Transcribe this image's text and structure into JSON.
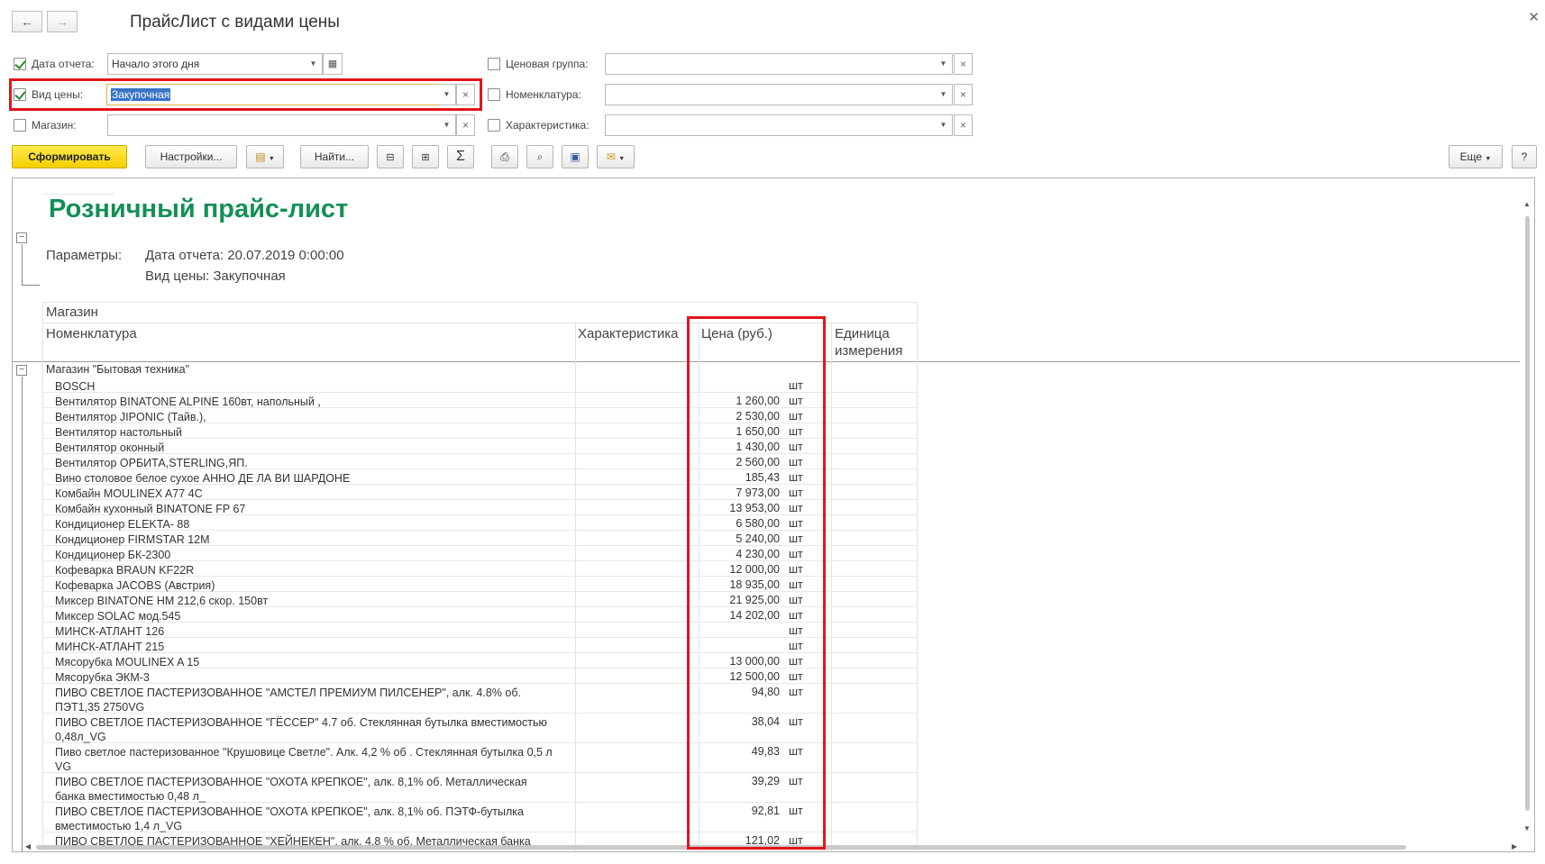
{
  "window": {
    "title": "ПрайсЛист с видами цены",
    "back_icon": "arrow-left-icon",
    "forward_icon": "arrow-right-icon",
    "close_icon": "close-icon"
  },
  "filters": {
    "report_date": {
      "label": "Дата отчета:",
      "value": "Начало этого дня",
      "checked": true
    },
    "price_type": {
      "label": "Вид цены:",
      "value": "Закупочная",
      "checked": true
    },
    "store": {
      "label": "Магазин:",
      "value": "",
      "checked": false
    },
    "price_group": {
      "label": "Ценовая группа:",
      "value": "",
      "checked": false
    },
    "nomenclature": {
      "label": "Номенклатура:",
      "value": "",
      "checked": false
    },
    "characteristic": {
      "label": "Характеристика:",
      "value": "",
      "checked": false
    }
  },
  "toolbar": {
    "generate": "Сформировать",
    "settings": "Настройки...",
    "find": "Найти...",
    "more": "Еще",
    "help": "?"
  },
  "report": {
    "title": "Розничный прайс-лист",
    "params_label": "Параметры:",
    "param_date": "Дата отчета: 20.07.2019 0:00:00",
    "param_price_type": "Вид цены: Закупочная",
    "header": {
      "store": "Магазин",
      "nomenclature": "Номенклатура",
      "characteristic": "Характеристика",
      "price": "Цена (руб.)",
      "unit_line1": "Единица",
      "unit_line2": "измерения"
    },
    "group": "Магазин \"Бытовая техника\"",
    "rows": [
      {
        "name": "BOSCH",
        "price": "",
        "unit": "шт"
      },
      {
        "name": "Вентилятор BINATONE ALPINE 160вт, напольный ,",
        "price": "1 260,00",
        "unit": "шт"
      },
      {
        "name": "Вентилятор JIPONIC (Тайв.),",
        "price": "2 530,00",
        "unit": "шт"
      },
      {
        "name": "Вентилятор настольный",
        "price": "1 650,00",
        "unit": "шт"
      },
      {
        "name": "Вентилятор оконный",
        "price": "1 430,00",
        "unit": "шт"
      },
      {
        "name": "Вентилятор ОРБИТА,STERLING,ЯП.",
        "price": "2 560,00",
        "unit": "шт"
      },
      {
        "name": "Вино столовое белое сухое АННО ДЕ ЛА ВИ ШАРДОНЕ",
        "price": "185,43",
        "unit": "шт"
      },
      {
        "name": "Комбайн MOULINEX  A77 4C",
        "price": "7 973,00",
        "unit": "шт"
      },
      {
        "name": "Комбайн кухонный BINATONE FP 67",
        "price": "13 953,00",
        "unit": "шт"
      },
      {
        "name": "Кондиционер ELEKTA- 88",
        "price": "6 580,00",
        "unit": "шт"
      },
      {
        "name": "Кондиционер FIRMSTAR 12M",
        "price": "5 240,00",
        "unit": "шт"
      },
      {
        "name": "Кондиционер БК-2300",
        "price": "4 230,00",
        "unit": "шт"
      },
      {
        "name": "Кофеварка BRAUN KF22R",
        "price": "12 000,00",
        "unit": "шт"
      },
      {
        "name": "Кофеварка JACOBS (Австрия)",
        "price": "18 935,00",
        "unit": "шт"
      },
      {
        "name": "Миксер BINATONE HM 212,6 скор. 150вт",
        "price": "21 925,00",
        "unit": "шт"
      },
      {
        "name": "Миксер SOLAC мод.545",
        "price": "14 202,00",
        "unit": "шт"
      },
      {
        "name": "МИНСК-АТЛАНТ 126",
        "price": "",
        "unit": "шт"
      },
      {
        "name": "МИНСК-АТЛАНТ 215",
        "price": "",
        "unit": "шт"
      },
      {
        "name": "Мясорубка MOULINEX  A 15",
        "price": "13 000,00",
        "unit": "шт"
      },
      {
        "name": "Мясорубка ЭКМ-3",
        "price": "12 500,00",
        "unit": "шт"
      },
      {
        "name": "ПИВО СВЕТЛОЕ ПАСТЕРИЗОВАННОЕ \"АМСТЕЛ ПРЕМИУМ ПИЛСЕНЕР\", алк. 4.8% об. ПЭТ1,35 2750VG",
        "price": "94,80",
        "unit": "шт"
      },
      {
        "name": "ПИВО СВЕТЛОЕ ПАСТЕРИЗОВАННОЕ \"ГЁССЕР\" 4.7 об. Стеклянная бутылка вместимостью 0,48л_VG",
        "price": "38,04",
        "unit": "шт"
      },
      {
        "name": "Пиво светлое пастеризованное \"Крушовице Светле\". Алк. 4,2 % об . Стеклянная бутылка 0,5 л VG",
        "price": "49,83",
        "unit": "шт"
      },
      {
        "name": "ПИВО СВЕТЛОЕ ПАСТЕРИЗОВАННОЕ \"ОХОТА КРЕПКОЕ\", алк. 8,1% об. Металлическая банка вместимостью 0,48 л_",
        "price": "39,29",
        "unit": "шт"
      },
      {
        "name": "ПИВО СВЕТЛОЕ ПАСТЕРИЗОВАННОЕ \"ОХОТА КРЕПКОЕ\", алк. 8,1% об. ПЭТФ-бутылка вместимостью 1,4 л_VG",
        "price": "92,81",
        "unit": "шт"
      },
      {
        "name": "ПИВО СВЕТЛОЕ ПАСТЕРИЗОВАННОЕ \"ХЕЙНЕКЕН\", алк. 4,8 % об. Металлическая банка",
        "price": "121,02",
        "unit": "шт"
      }
    ]
  },
  "colors": {
    "report_title": "#139056",
    "highlight_box": "#e3151a",
    "generate_button": "#f5cf00",
    "selection": "#3873c6"
  }
}
